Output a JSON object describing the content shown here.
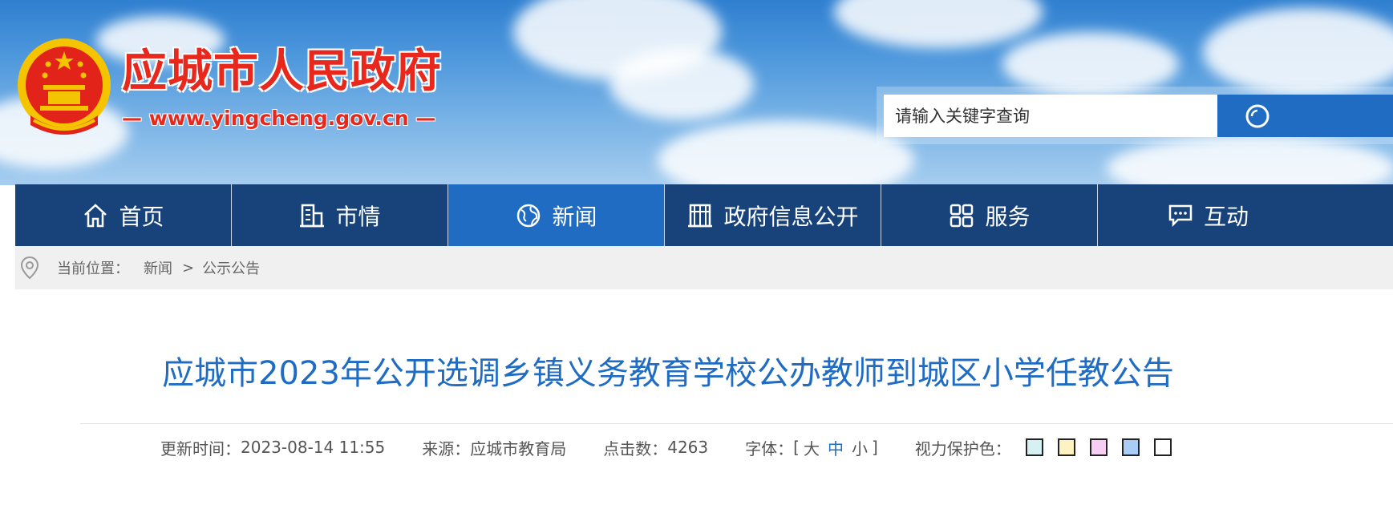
{
  "header": {
    "site_title": "应城市人民政府",
    "site_url": "— www.yingcheng.gov.cn —",
    "emblem_icon": "national-emblem-icon"
  },
  "search": {
    "placeholder": "请输入关键字查询",
    "button_icon": "search-icon"
  },
  "nav": {
    "items": [
      {
        "label": "首页",
        "icon": "home-icon"
      },
      {
        "label": "市情",
        "icon": "building-icon"
      },
      {
        "label": "新闻",
        "icon": "globe-icon",
        "active": true
      },
      {
        "label": "政府信息公开",
        "icon": "government-building-icon"
      },
      {
        "label": "服务",
        "icon": "grid-icon"
      },
      {
        "label": "互动",
        "icon": "chat-icon"
      }
    ],
    "active_color": "#1f6cc2",
    "base_color": "#17427a"
  },
  "breadcrumb": {
    "label": "当前位置：",
    "items": [
      "新闻",
      "公示公告"
    ],
    "separator": ">"
  },
  "article": {
    "title": "应城市2023年公开选调乡镇义务教育学校公办教师到城区小学任教公告",
    "meta": {
      "updated_label": "更新时间：",
      "updated_value": "2023-08-14 11:55",
      "source_label": "来源：",
      "source_value": "应城市教育局",
      "clicks_label": "点击数：",
      "clicks_value": "4263",
      "font_label": "字体：",
      "font_open": "[",
      "font_large": "大",
      "font_medium": "中",
      "font_small": "小",
      "font_close": "]",
      "eye_label": "视力保护色：",
      "eye_colors": [
        "#d6f1f1",
        "#fdf3c2",
        "#f6cdf3",
        "#a9cdf5",
        "#ffffff"
      ]
    }
  }
}
